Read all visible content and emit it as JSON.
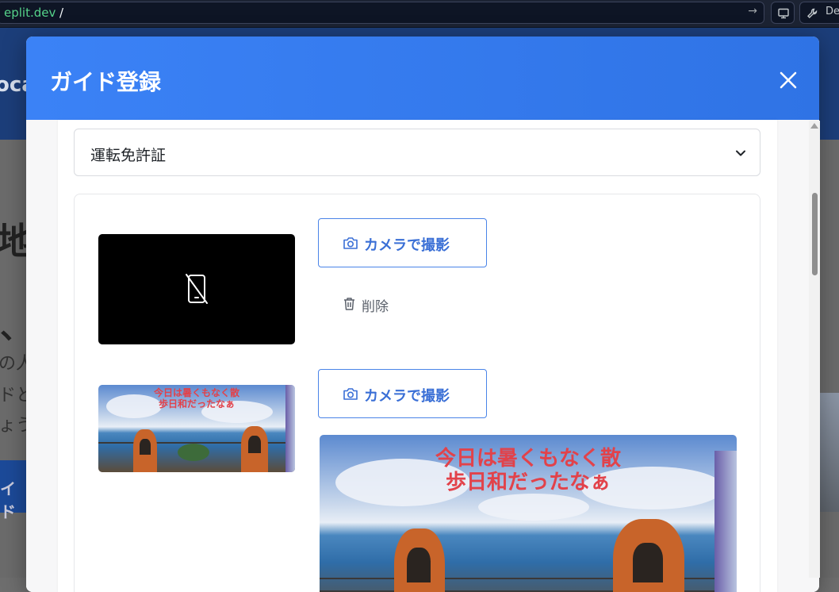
{
  "browser": {
    "url_domain": "eplit.dev",
    "url_path": "/",
    "dev_label": "De"
  },
  "background_page": {
    "header_fragment": "oca",
    "heading_fragment": "地",
    "heading2_fragment": "、",
    "lines": [
      "の人",
      "ドと",
      "ょう"
    ],
    "button_fragment": "イド"
  },
  "modal": {
    "title": "ガイド登録",
    "close_icon": "close-icon",
    "document_select": {
      "selected": "運転免許証",
      "icon": "chevron-down-icon"
    },
    "photo_slots": [
      {
        "preview": "no-image",
        "preview_icon": "phone-off-icon",
        "camera_label": "カメラで撮影",
        "delete_label": "削除"
      },
      {
        "preview": "photo",
        "photo_caption_lines": [
          "今日は暑くもなく散",
          "歩日和だったなぁ"
        ],
        "camera_label": "カメラで撮影"
      }
    ]
  },
  "colors": {
    "header_blue": "#3b82f6",
    "accent_blue": "#3a6fd6",
    "caption_red": "#e2424a"
  }
}
